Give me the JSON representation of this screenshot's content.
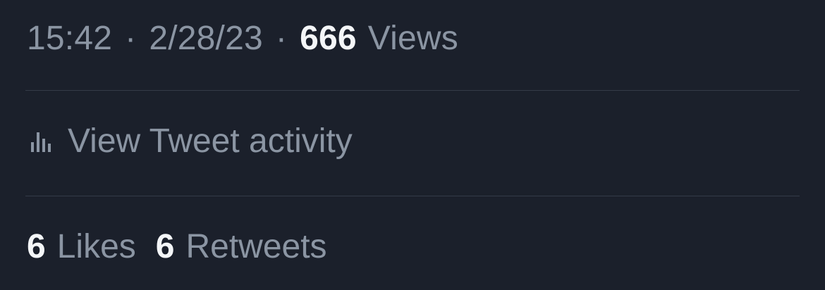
{
  "tweet_meta": {
    "time": "15:42",
    "separator": "·",
    "date": "2/28/23",
    "views_count": "666",
    "views_label": "Views"
  },
  "activity": {
    "icon": "bar-chart-icon",
    "label": "View Tweet activity"
  },
  "engagement": {
    "likes_count": "6",
    "likes_label": "Likes",
    "retweets_count": "6",
    "retweets_label": "Retweets"
  },
  "colors": {
    "background": "#1b202b",
    "muted_text": "#8b95a3",
    "primary_text": "#f4f6f8",
    "divider": "#343b48"
  }
}
